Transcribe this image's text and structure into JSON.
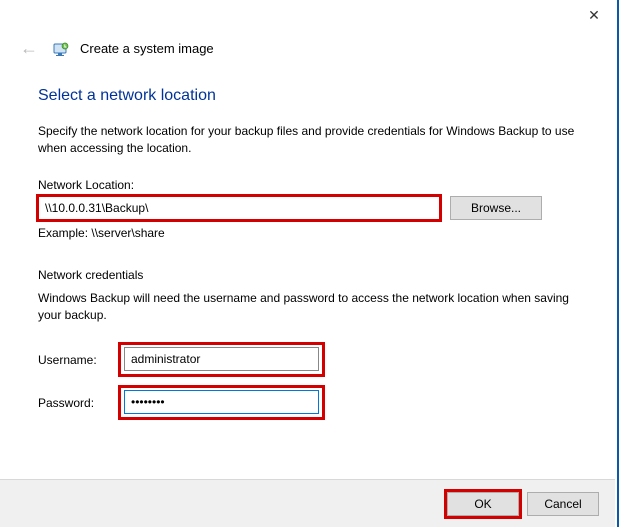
{
  "titlebar": {
    "close_glyph": "✕"
  },
  "header": {
    "back_glyph": "←",
    "wizard_title": "Create a system image"
  },
  "page": {
    "heading": "Select a network location",
    "instruction": "Specify the network location for your backup files and provide credentials for Windows Backup to use when accessing the location.",
    "location_label": "Network Location:",
    "location_value": "\\\\10.0.0.31\\Backup\\",
    "browse_label": "Browse...",
    "example_text": "Example: \\\\server\\share",
    "credentials_header": "Network credentials",
    "credentials_instruction": "Windows Backup will need the username and password to access the network location when saving your backup.",
    "username_label": "Username:",
    "username_value": "administrator",
    "password_label": "Password:",
    "password_value": "••••••••"
  },
  "footer": {
    "ok_label": "OK",
    "cancel_label": "Cancel"
  }
}
